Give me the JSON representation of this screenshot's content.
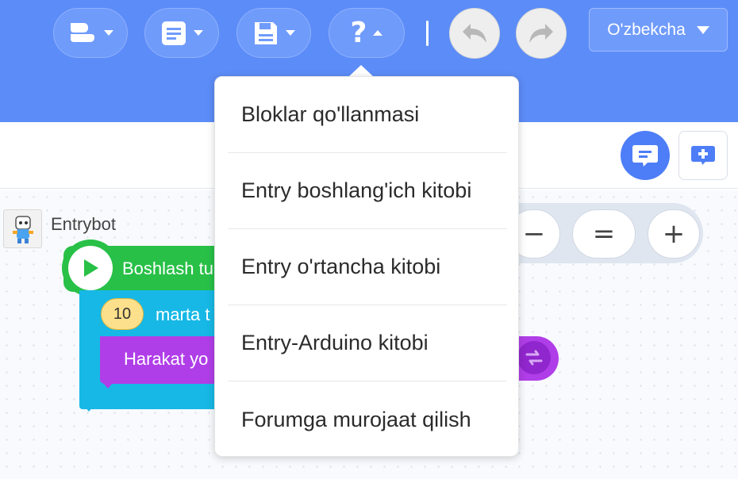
{
  "topbar": {
    "buttons": [
      {
        "name": "blocks-menu",
        "icon": "block-icon"
      },
      {
        "name": "document-menu",
        "icon": "document-icon"
      },
      {
        "name": "save-menu",
        "icon": "save-icon"
      },
      {
        "name": "help-menu",
        "icon": "help-icon",
        "label": "?"
      }
    ],
    "undo_icon": "undo-icon",
    "redo_icon": "redo-icon",
    "language": "O'zbekcha"
  },
  "toolbar": {
    "chat_icon": "chat-icon",
    "add_icon": "add-comment-icon"
  },
  "workspace": {
    "object_name": "Entrybot",
    "blocks": {
      "start_label": "Boshlash tu",
      "repeat_count": "10",
      "repeat_label": "marta t",
      "move_label": "Harakat yo"
    },
    "zoom": {
      "minus": "−",
      "reset": "=",
      "plus": "+"
    }
  },
  "help_menu": {
    "items": [
      "Bloklar qo'llanmasi",
      "Entry boshlang'ich kitobi",
      "Entry o'rtancha kitobi",
      "Entry-Arduino kitobi",
      "Forumga murojaat qilish"
    ]
  },
  "colors": {
    "topbar": "#5c8cf7",
    "start_block": "#28c047",
    "repeat_block": "#17b8e6",
    "move_block": "#b03ee8",
    "accent": "#4d7ef7"
  }
}
